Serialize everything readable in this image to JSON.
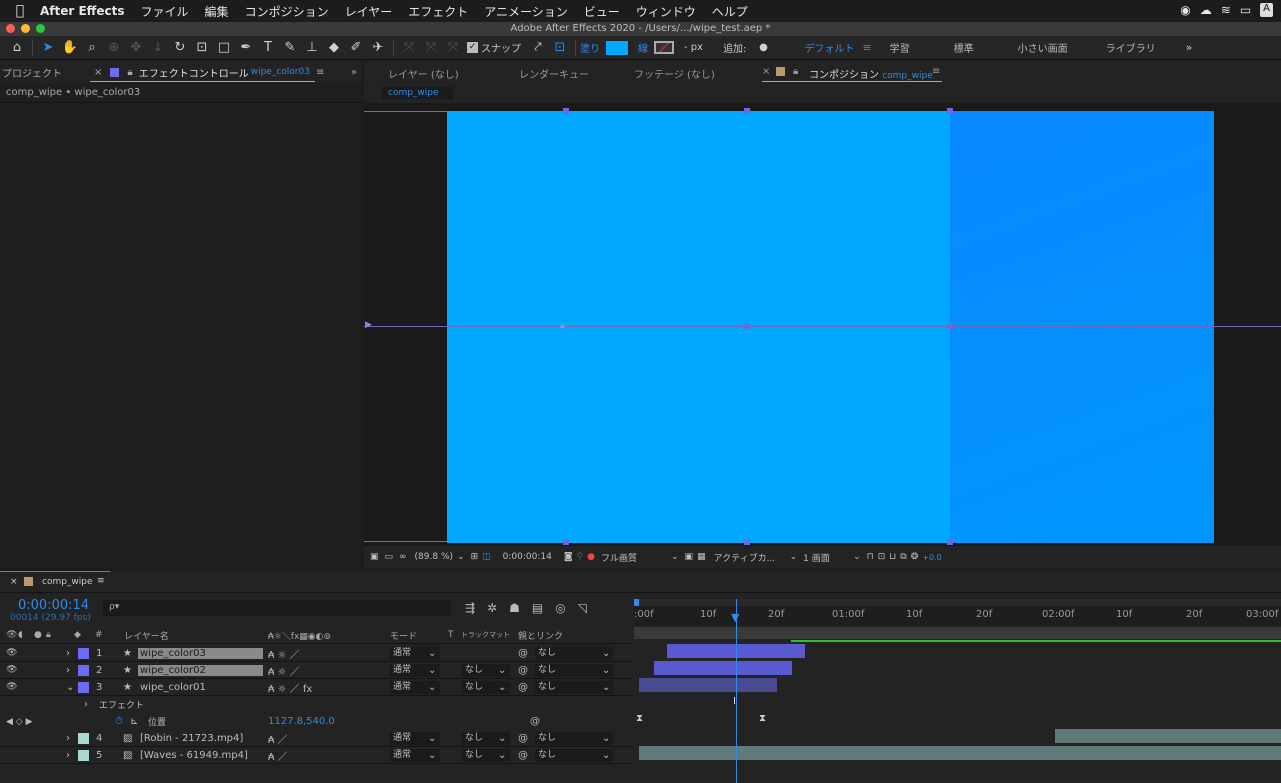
{
  "menubar": {
    "app": "After Effects",
    "items": [
      "ファイル",
      "編集",
      "コンポジション",
      "レイヤー",
      "エフェクト",
      "アニメーション",
      "ビュー",
      "ウィンドウ",
      "ヘルプ"
    ]
  },
  "window": {
    "title": "Adobe After Effects 2020 - /Users/.../wipe_test.aep *"
  },
  "toolbar": {
    "snap": "スナップ",
    "fill": "塗り",
    "stroke": "線",
    "px": "- px",
    "add": "追加:",
    "workspaces": [
      "デフォルト",
      "学習",
      "標準",
      "小さい画面",
      "ライブラリ"
    ]
  },
  "left_panel": {
    "tab_project": "プロジェクト",
    "tab_effects": "エフェクトコントロール",
    "effects_layer": "wipe_color03",
    "breadcrumb": "comp_wipe • wipe_color03"
  },
  "viewer_tabs": {
    "layer": "レイヤー (なし)",
    "render": "レンダーキュー",
    "footage": "フッテージ (なし)",
    "comp": "コンポジション",
    "comp_name": "comp_wipe",
    "subtab": "comp_wipe"
  },
  "viewer_bar": {
    "zoom": "(89.8 %)",
    "time": "0:00:00:14",
    "quality": "フル画質",
    "camera": "アクティブカ...",
    "views": "1 画面",
    "exposure": "+0.0"
  },
  "timeline": {
    "comp_tab": "comp_wipe",
    "timecode": "0:00:00:14",
    "frame_info": "00014 (29.97 fps)",
    "search_placeholder": "ρ▾",
    "col_layer": "レイヤー名",
    "col_mode": "モード",
    "col_t": "T",
    "col_trkmat": "トラックマット",
    "col_parent": "親とリンク",
    "ruler": [
      ":00f",
      "10f",
      "20f",
      "01:00f",
      "10f",
      "20f",
      "02:00f",
      "10f",
      "20f",
      "03:00f"
    ],
    "layers": [
      {
        "num": "1",
        "name": "wipe_color03",
        "mode": "通常",
        "trkmat": "",
        "parent": "なし",
        "color": "#6c6cf0"
      },
      {
        "num": "2",
        "name": "wipe_color02",
        "mode": "通常",
        "trkmat": "なし",
        "parent": "なし",
        "color": "#6c6cf0"
      },
      {
        "num": "3",
        "name": "wipe_color01",
        "mode": "通常",
        "trkmat": "なし",
        "parent": "なし",
        "color": "#6c6cf0"
      },
      {
        "num": "4",
        "name": "[Robin - 21723.mp4]",
        "mode": "通常",
        "trkmat": "なし",
        "parent": "なし",
        "color": "#a8d8d0"
      },
      {
        "num": "5",
        "name": "[Waves - 61949.mp4]",
        "mode": "通常",
        "trkmat": "なし",
        "parent": "なし",
        "color": "#a8d8d0"
      }
    ],
    "effects_label": "エフェクト",
    "position_label": "位置",
    "position_value": "1127.8,540.0"
  },
  "colors": {
    "comp_left": "#00a8ff",
    "comp_right": "#0090ff",
    "accent": "#2d8ceb"
  }
}
